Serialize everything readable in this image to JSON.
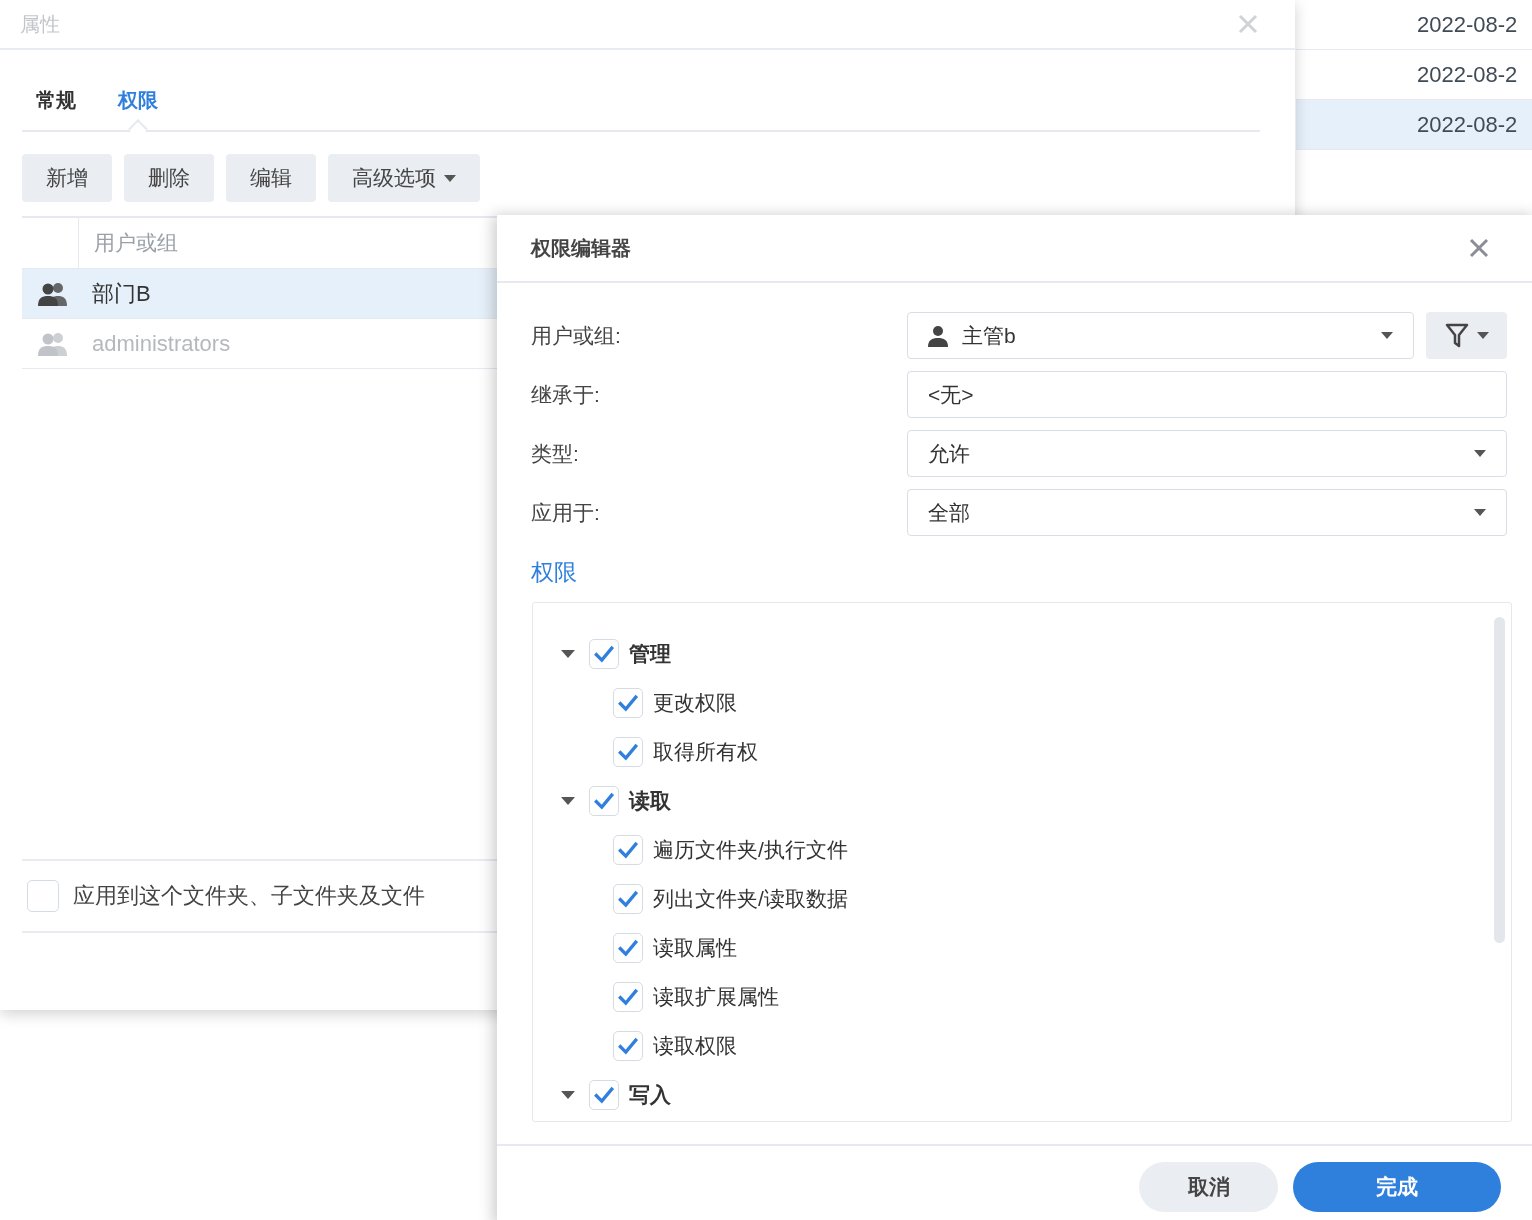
{
  "background_table": {
    "rows": [
      {
        "date": "2022-08-2",
        "selected": false
      },
      {
        "date": "2022-08-2",
        "selected": false
      },
      {
        "date": "2022-08-2",
        "selected": true
      }
    ]
  },
  "properties_window": {
    "title": "属性",
    "tabs": [
      {
        "label": "常规",
        "selected": false
      },
      {
        "label": "权限",
        "selected": true
      }
    ],
    "toolbar": [
      {
        "label": "新增",
        "dropdown": false
      },
      {
        "label": "删除",
        "dropdown": false
      },
      {
        "label": "编辑",
        "dropdown": false
      },
      {
        "label": "高级选项",
        "dropdown": true
      }
    ],
    "table": {
      "columns": [
        "用户或组"
      ],
      "rows": [
        {
          "name": "部门B",
          "selected": true,
          "disabled": false
        },
        {
          "name": "administrators",
          "selected": false,
          "disabled": true
        }
      ]
    },
    "apply_checkbox": {
      "label": "应用到这个文件夹、子文件夹及文件",
      "checked": false
    }
  },
  "permission_editor": {
    "title": "权限编辑器",
    "fields": [
      {
        "kind": "user",
        "label": "用户或组:",
        "value": "主管b"
      },
      {
        "kind": "text",
        "label": "继承于:",
        "value": "<无>"
      },
      {
        "kind": "select",
        "label": "类型:",
        "value": "允许"
      },
      {
        "kind": "select",
        "label": "应用于:",
        "value": "全部"
      }
    ],
    "section_title": "权限",
    "permissions": [
      {
        "label": "管理",
        "checked": true,
        "expanded": true,
        "children": [
          {
            "label": "更改权限",
            "checked": true
          },
          {
            "label": "取得所有权",
            "checked": true
          }
        ]
      },
      {
        "label": "读取",
        "checked": true,
        "expanded": true,
        "children": [
          {
            "label": "遍历文件夹/执行文件",
            "checked": true
          },
          {
            "label": "列出文件夹/读取数据",
            "checked": true
          },
          {
            "label": "读取属性",
            "checked": true
          },
          {
            "label": "读取扩展属性",
            "checked": true
          },
          {
            "label": "读取权限",
            "checked": true
          }
        ]
      },
      {
        "label": "写入",
        "checked": true,
        "expanded": true
      }
    ],
    "buttons": [
      {
        "label": "取消",
        "kind": "secondary"
      },
      {
        "label": "完成",
        "kind": "primary"
      }
    ]
  }
}
